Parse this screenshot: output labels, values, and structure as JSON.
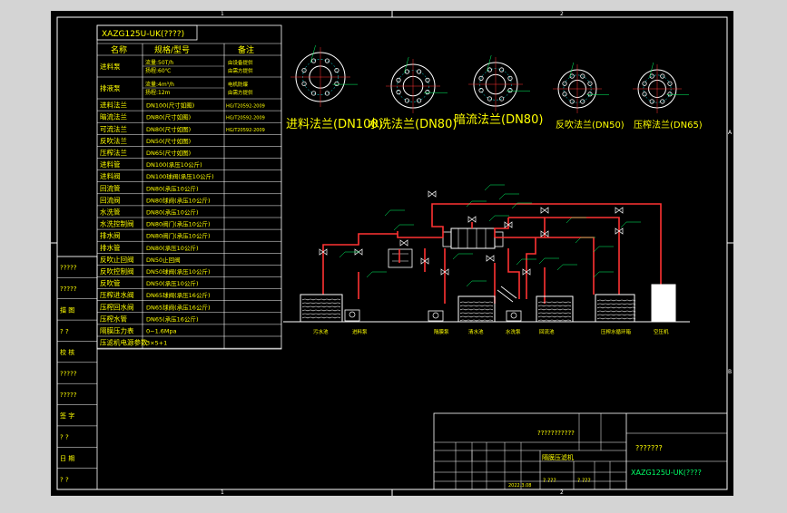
{
  "colors": {
    "bg": "#000000",
    "frame": "#ffffff",
    "table": "#ffffff",
    "text_yellow": "#ffff00",
    "text_white": "#ffffff",
    "pipe": "#ff3333",
    "label_green": "#00ff66",
    "cyan": "#00ffff"
  },
  "border_markers": {
    "top": [
      "1",
      "2"
    ],
    "right": [
      "A",
      "B"
    ]
  },
  "drawing_code": "XAZG125U-UK(????)",
  "spec_table": {
    "headers": {
      "name": "名称",
      "spec": "规格/型号",
      "note": "备注"
    },
    "rows": [
      {
        "name": "进料泵",
        "spec": "流量:50T/h",
        "spec2": "扬程:60℃",
        "note": "由设备提供",
        "note2": "由需方提供"
      },
      {
        "name": "排液泵",
        "spec": "流量:4m³/h",
        "spec2": "扬程:12m",
        "note": "电机防爆",
        "note2": "由需方提供"
      },
      {
        "name": "进料法兰",
        "spec": "DN100(尺寸如图)",
        "note": "HG/T20592-2009"
      },
      {
        "name": "暗流法兰",
        "spec": "DN80(尺寸如图)",
        "note": "HG/T20592-2009"
      },
      {
        "name": "可流法兰",
        "spec": "DN80(尺寸如图)",
        "note": "HG/T20592-2009"
      },
      {
        "name": "反吹法兰",
        "spec": "DN50(尺寸如图)",
        "note": ""
      },
      {
        "name": "压榨法兰",
        "spec": "DN65(尺寸如图)",
        "note": ""
      },
      {
        "name": "进料管",
        "spec": "DN100(承压10公斤)",
        "note": ""
      },
      {
        "name": "进料阀",
        "spec": "DN100球阀(承压10公斤)",
        "note": ""
      },
      {
        "name": "回流管",
        "spec": "DN80(承压10公斤)",
        "note": ""
      },
      {
        "name": "回流阀",
        "spec": "DN80球阀(承压10公斤)",
        "note": ""
      },
      {
        "name": "水洗管",
        "spec": "DN80(承压10公斤)",
        "note": ""
      },
      {
        "name": "水洗控制阀",
        "spec": "DN80阀门(承压10公斤)",
        "note": ""
      },
      {
        "name": "排水阀",
        "spec": "DN80阀门(承压10公斤)",
        "note": ""
      },
      {
        "name": "排水管",
        "spec": "DN80(承压10公斤)",
        "note": ""
      },
      {
        "name": "反吹止回阀",
        "spec": "DN50止回阀",
        "note": ""
      },
      {
        "name": "反吹控制阀",
        "spec": "DN50球阀(承压10公斤)",
        "note": ""
      },
      {
        "name": "反吹管",
        "spec": "DN50(承压10公斤)",
        "note": ""
      },
      {
        "name": "压榨进水阀",
        "spec": "DN65球阀(承压16公斤)",
        "note": ""
      },
      {
        "name": "压榨回水阀",
        "spec": "DN65球阀(承压16公斤)",
        "note": ""
      },
      {
        "name": "压榨水管",
        "spec": "DN65(承压16公斤)",
        "note": ""
      },
      {
        "name": "隔膜压力表",
        "spec": "0~1.6Mpa",
        "note": ""
      },
      {
        "name": "压滤机电源参数",
        "spec": "3×5+1",
        "note": ""
      }
    ]
  },
  "flanges": [
    {
      "label": "进料法兰(DN100)"
    },
    {
      "label": "水洗法兰(DN80)"
    },
    {
      "label": "暗流法兰(DN80)"
    },
    {
      "label": "反吹法兰(DN50)"
    },
    {
      "label": "压榨法兰(DN65)"
    }
  ],
  "equipment_labels": [
    "污水池",
    "进料泵",
    "隔膜泵",
    "清水池",
    "水洗泵",
    "回流池",
    "压榨水循环箱",
    "空压机"
  ],
  "title_block": {
    "title": "???????????",
    "company": "???????",
    "code": "XAZG125U-UK(????",
    "date": "2022.3.08",
    "material": "隔膜压滤机",
    "mark1": "? ???",
    "mark2": "? ???"
  },
  "left_margin": {
    "labels": [
      "?????",
      "?????",
      "描 图",
      "? ?",
      "校 核",
      "?????",
      "?????",
      "签 字",
      "? ?",
      "日 期",
      "? ?"
    ]
  }
}
